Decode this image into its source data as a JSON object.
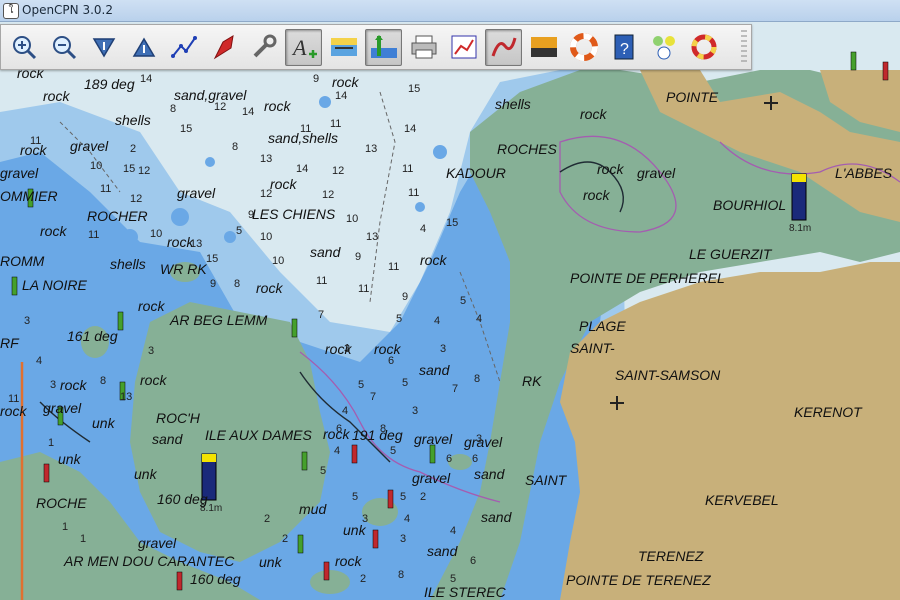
{
  "window": {
    "title": "OpenCPN 3.0.2",
    "app_icon_glyph": "ใ"
  },
  "toolbar": {
    "buttons": [
      {
        "name": "zoom-in-icon",
        "active": false
      },
      {
        "name": "zoom-out-icon",
        "active": false
      },
      {
        "name": "scale-in-icon",
        "active": false
      },
      {
        "name": "scale-out-icon",
        "active": false
      },
      {
        "name": "route-icon",
        "active": false
      },
      {
        "name": "auto-follow-icon",
        "active": false
      },
      {
        "name": "settings-wrench-icon",
        "active": false
      },
      {
        "name": "text-toggle-icon",
        "active": true
      },
      {
        "name": "current-display-icon",
        "active": false
      },
      {
        "name": "tide-display-icon",
        "active": true
      },
      {
        "name": "print-icon",
        "active": false
      },
      {
        "name": "route-manager-icon",
        "active": false
      },
      {
        "name": "track-icon",
        "active": true
      },
      {
        "name": "color-scheme-icon",
        "active": false
      },
      {
        "name": "mob-lifebuoy-icon",
        "active": false
      },
      {
        "name": "help-icon",
        "active": false
      },
      {
        "name": "ais-icon",
        "active": false
      },
      {
        "name": "tracking-icon",
        "active": false
      }
    ]
  },
  "chart": {
    "colors": {
      "deep": "#d9e9f0",
      "medium": "#9fc9ec",
      "shallow": "#6aa8e6",
      "intertidal": "#86b096",
      "land": "#c8b07a",
      "contour": "#a45db0"
    },
    "place_names": [
      "POINTE",
      "ROCHES",
      "KADOUR",
      "L'ABBES",
      "BOURHIOL",
      "LE GUERZIT",
      "POINTE DE PERHEREL",
      "PLAGE",
      "SAINT-",
      "SAINT-SAMSON",
      "KERENOT",
      "RK",
      "SAINT",
      "KERVEBEL",
      "TERENEZ",
      "POINTE DE TERENEZ",
      "ILE STEREC",
      "LES CHIENS",
      "ROCHER",
      "OMMIER",
      "ROMM",
      "LA NOIRE",
      "WR RK",
      "AR BEG LEMM",
      "ROC'H",
      "ILE AUX DAMES",
      "ROCHE",
      "AR MEN DOU CARANTEC",
      "RF"
    ],
    "seabed_labels": [
      "rock",
      "189 deg",
      "sand,gravel",
      "rock",
      "rock",
      "shells",
      "gravel",
      "rock",
      "sand,shells",
      "shells",
      "rock",
      "rock",
      "gravel",
      "gravel",
      "rock",
      "rock",
      "gravel",
      "rock",
      "rock",
      "shells",
      "sand",
      "rock",
      "rock",
      "rock",
      "rock",
      "161 deg",
      "rock",
      "rock",
      "rock",
      "rock",
      "sand",
      "rock",
      "gravel",
      "unk",
      "sand",
      "191 deg",
      "gravel",
      "gravel",
      "unk",
      "unk",
      "gravel",
      "sand",
      "160 deg",
      "mud",
      "sand",
      "unk",
      "gravel",
      "unk",
      "rock",
      "sand",
      "160 deg",
      "rock"
    ],
    "soundings": [
      "14",
      "9",
      "15",
      "14",
      "8",
      "12",
      "14",
      "15",
      "8",
      "11",
      "11",
      "14",
      "2",
      "11",
      "13",
      "15",
      "12",
      "14",
      "12",
      "13",
      "12",
      "11",
      "10",
      "9",
      "12",
      "11",
      "12",
      "10",
      "11",
      "10",
      "13",
      "11",
      "5",
      "10",
      "13",
      "4",
      "15",
      "15",
      "9",
      "11",
      "11",
      "10",
      "11",
      "9",
      "8",
      "9",
      "5",
      "7",
      "4",
      "5",
      "4",
      "6",
      "3",
      "3",
      "3",
      "4",
      "3",
      "3",
      "5",
      "5",
      "8",
      "7",
      "13",
      "7",
      "11",
      "4",
      "3",
      "6",
      "8",
      "3",
      "8",
      "4",
      "5",
      "6",
      "5",
      "6",
      "5",
      "5",
      "2",
      "4",
      "3",
      "2",
      "4",
      "2",
      "6",
      "8",
      "5",
      "2",
      "3",
      "1",
      "1",
      "1"
    ],
    "tide_station_labels": [
      "8.1m",
      "8.1m"
    ]
  }
}
